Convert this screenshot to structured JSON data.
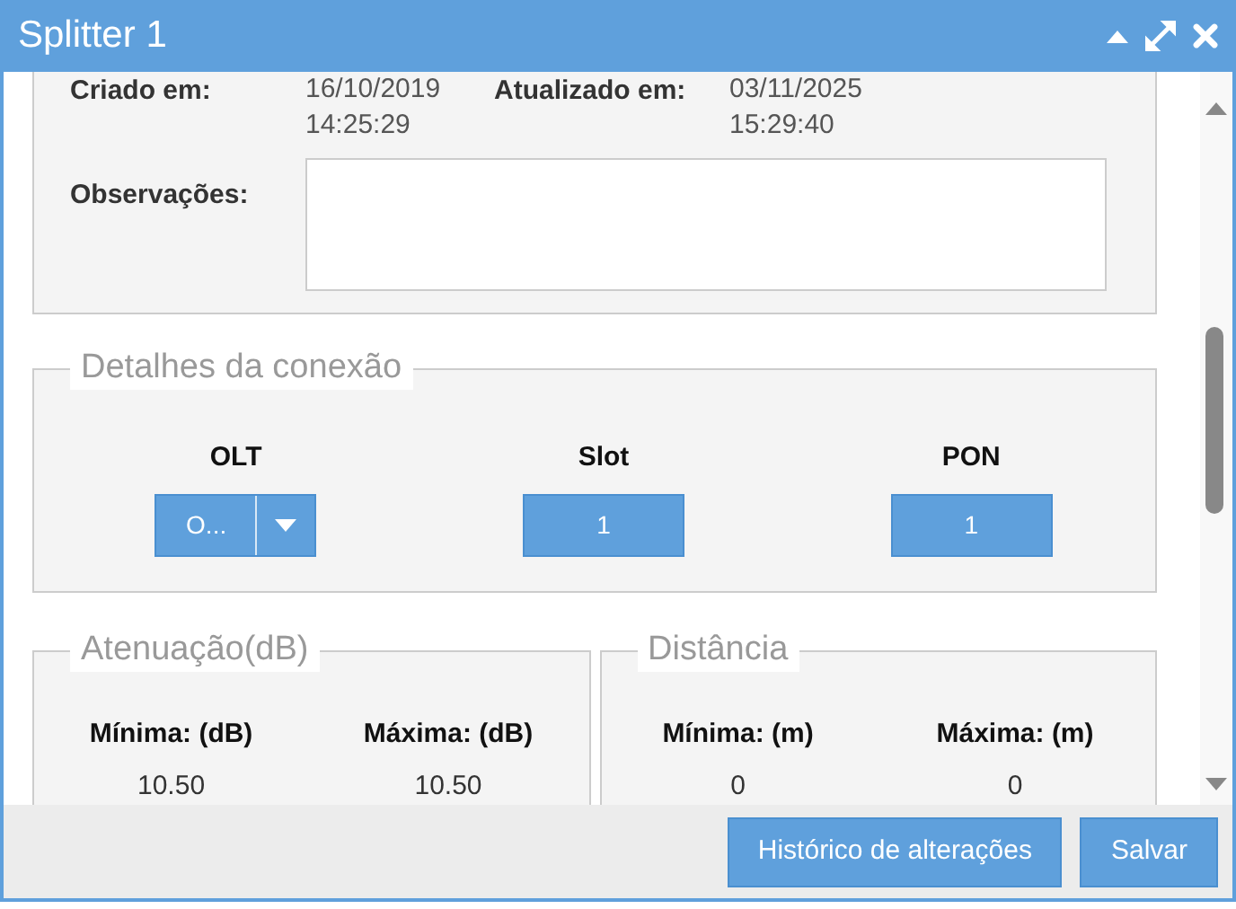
{
  "window": {
    "title": "Splitter 1"
  },
  "info": {
    "fields": [
      {
        "label": "Criado em:",
        "value_lines": [
          "16/10/2019",
          "14:25:29"
        ]
      },
      {
        "label": "Atualizado em:",
        "value_lines": [
          "03/11/2025",
          "15:29:40"
        ]
      }
    ],
    "notes": {
      "label": "Observações:"
    }
  },
  "connection": {
    "legend": "Detalhes da conexão",
    "fields": [
      {
        "label": "OLT",
        "kind": "select",
        "value": "O..."
      },
      {
        "label": "Slot",
        "kind": "number",
        "value": "1"
      },
      {
        "label": "PON",
        "kind": "number",
        "value": "1"
      }
    ]
  },
  "ranges": [
    {
      "legend": "Atenuação(dB)",
      "columns": [
        {
          "label": "Mínima: (dB)",
          "value": "10.50"
        },
        {
          "label": "Máxima: (dB)",
          "value": "10.50"
        }
      ]
    },
    {
      "legend": "Distância",
      "columns": [
        {
          "label": "Mínima: (m)",
          "value": "0"
        },
        {
          "label": "Máxima: (m)",
          "value": "0"
        }
      ]
    }
  ],
  "buttons": [
    "Histórico de alterações",
    "Salvar"
  ]
}
